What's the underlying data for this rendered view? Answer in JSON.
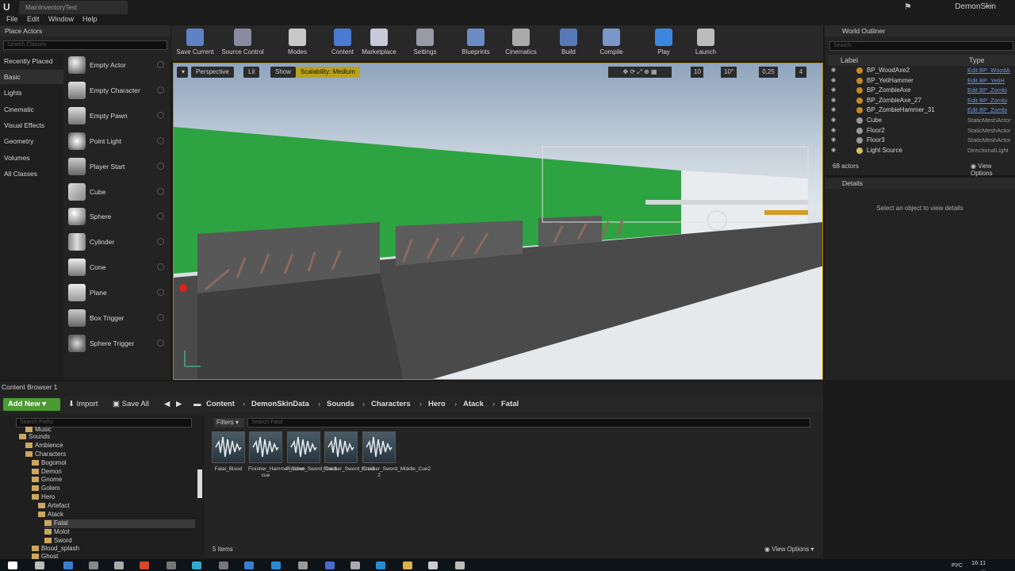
{
  "window": {
    "doc_tab": "MainInventoryTest",
    "project": "DemonSkin"
  },
  "menu": [
    "File",
    "Edit",
    "Window",
    "Help"
  ],
  "place_actors": {
    "title": "Place Actors",
    "search_placeholder": "Search Classes",
    "categories": [
      "Recently Placed",
      "Basic",
      "Lights",
      "Cinematic",
      "Visual Effects",
      "Geometry",
      "Volumes",
      "All Classes"
    ],
    "selected_category": "Basic",
    "actors": [
      "Empty Actor",
      "Empty Character",
      "Empty Pawn",
      "Point Light",
      "Player Start",
      "Cube",
      "Sphere",
      "Cylinder",
      "Cone",
      "Plane",
      "Box Trigger",
      "Sphere Trigger"
    ]
  },
  "toolbar": [
    "Save Current",
    "Source Control",
    "Modes",
    "Content",
    "Marketplace",
    "Settings",
    "Blueprints",
    "Cinematics",
    "Build",
    "Compile",
    "Play",
    "Launch"
  ],
  "viewport": {
    "perspective": "Perspective",
    "lit": "Lit",
    "show": "Show",
    "scalability": "Scalability: Medium",
    "grid_snap": "10",
    "rot_snap": "10°",
    "scale_snap": "0,25",
    "cam_speed": "4"
  },
  "outliner": {
    "title": "World Outliner",
    "search_placeholder": "Search...",
    "col_label": "Label",
    "col_type": "Type",
    "rows": [
      {
        "label": "BP_WoodAxe2",
        "type": "Edit BP_WoodA"
      },
      {
        "label": "BP_YetiHammer",
        "type": "Edit BP_YetiH"
      },
      {
        "label": "BP_ZombieAxe",
        "type": "Edit BP_Zombi"
      },
      {
        "label": "BP_ZombieAxe_27",
        "type": "Edit BP_Zombi"
      },
      {
        "label": "BP_ZombieHammer_31",
        "type": "Edit BP_Zombi"
      },
      {
        "label": "Cube",
        "type": "StaticMeshActor"
      },
      {
        "label": "Floor2",
        "type": "StaticMeshActor"
      },
      {
        "label": "Floor3",
        "type": "StaticMeshActor"
      },
      {
        "label": "Light Source",
        "type": "DirectionalLight"
      }
    ],
    "count": "68 actors",
    "view_options": "View Options"
  },
  "details": {
    "title": "Details",
    "empty": "Select an object to view details"
  },
  "content_browser": {
    "title": "Content Browser 1",
    "add_new": "Add New",
    "import": "Import",
    "save_all": "Save All",
    "path": [
      "Content",
      "DemonSkinData",
      "Sounds",
      "Characters",
      "Hero",
      "Atack",
      "Fatal"
    ],
    "tree_search_placeholder": "Search Paths",
    "tree": [
      "Music",
      "Sounds",
      "Ambience",
      "Characters",
      "Bogomol",
      "Demon",
      "Gnome",
      "Golem",
      "Hero",
      "Artefact",
      "Atack",
      "Fatal",
      "Molot",
      "Sword",
      "Blood_splash",
      "Ghost"
    ],
    "filters": "Filters",
    "asset_search_placeholder": "Search Fatal",
    "assets": [
      "Fatal_Blood",
      "Finisher_Hammer_Down cue",
      "Finisher_Sword_Cue1",
      "Finisher_Sword_Cue3",
      "Finisher_Sword_Middle_Cue2 2"
    ],
    "item_count": "5 items",
    "view_options": "View Options"
  },
  "taskbar": {
    "lang": "РУС",
    "time": "16:11",
    "date": "..."
  }
}
